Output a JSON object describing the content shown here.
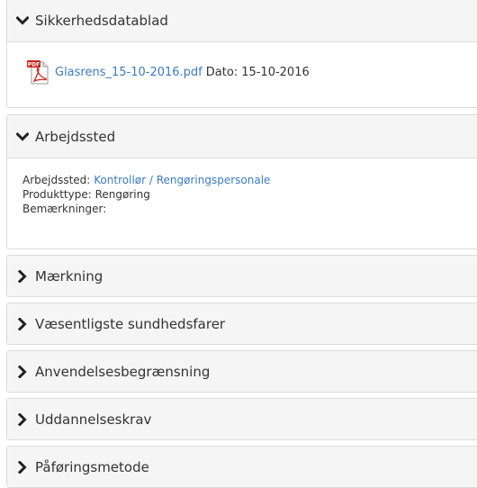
{
  "sections": {
    "sds": {
      "title": "Sikkerhedsdatablad",
      "file_name": "Glasrens_15-10-2016.pdf",
      "date_label": "Dato:",
      "date_value": "15-10-2016"
    },
    "workplace": {
      "title": "Arbejdssted",
      "workplace_label": "Arbejdssted:",
      "workplace_value": "Kontrollør / Rengøringspersonale",
      "product_type_label": "Produkttype:",
      "product_type_value": "Rengøring",
      "remarks_label": "Bemærkninger:"
    },
    "collapsed": [
      {
        "title": "Mærkning"
      },
      {
        "title": "Væsentligste sundhedsfarer"
      },
      {
        "title": "Anvendelsesbegrænsning"
      },
      {
        "title": "Uddannelseskrav"
      },
      {
        "title": "Påføringsmetode"
      }
    ]
  },
  "icons": {
    "expanded": "chevron-down-icon",
    "collapsed": "chevron-right-icon",
    "file": "pdf-file-icon"
  },
  "colors": {
    "link": "#3b7bbf",
    "heading_bg": "#f5f5f5",
    "border": "#dcdcdc"
  }
}
